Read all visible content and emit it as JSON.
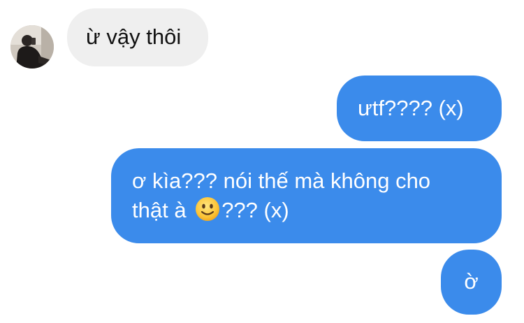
{
  "messages": [
    {
      "sender": "other",
      "text": "ừ vậy thôi"
    },
    {
      "sender": "me",
      "text": "ưtf???? (x)"
    },
    {
      "sender": "me",
      "line1": "ơ kìa??? nói thế mà không cho",
      "line2_before": "thật à",
      "emoji": "slightly-smiling-face-emoji",
      "line2_after": "??? (x)"
    },
    {
      "sender": "me",
      "text": "ờ"
    }
  ],
  "colors": {
    "outgoing_bubble": "#3b8beb",
    "incoming_bubble": "#efefef",
    "background": "#ffffff"
  }
}
